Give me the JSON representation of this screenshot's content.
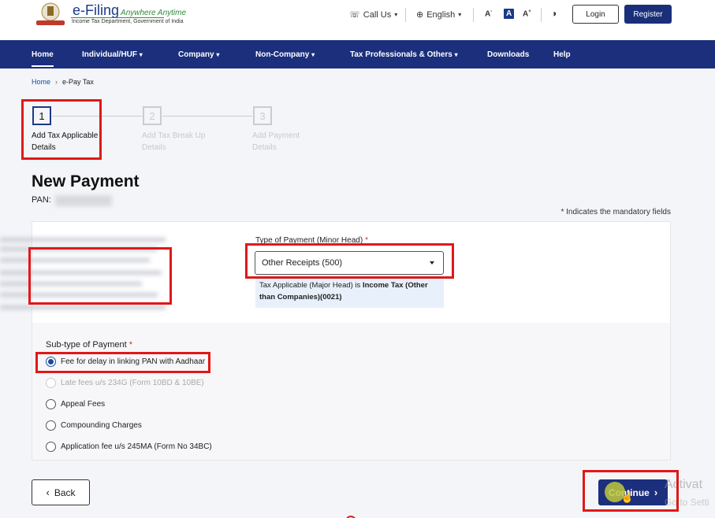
{
  "header": {
    "logo_title": "e-Filing",
    "logo_tagline": "Anywhere Anytime",
    "logo_subtitle": "Income Tax Department, Government of India",
    "call_us": "Call Us",
    "language": "English",
    "font_decrease": "A",
    "font_normal": "A",
    "font_increase": "A",
    "login": "Login",
    "register": "Register"
  },
  "nav": {
    "items": [
      "Home",
      "Individual/HUF",
      "Company",
      "Non-Company",
      "Tax Professionals & Others",
      "Downloads",
      "Help"
    ]
  },
  "breadcrumb": {
    "home": "Home",
    "current": "e-Pay Tax"
  },
  "stepper": [
    {
      "number": "1",
      "label": "Add Tax Applicable Details"
    },
    {
      "number": "2",
      "label": "Add Tax Break Up Details"
    },
    {
      "number": "3",
      "label": "Add Payment Details"
    }
  ],
  "page": {
    "title": "New Payment",
    "pan_label": "PAN:",
    "mandatory_note": "* Indicates the mandatory fields"
  },
  "form": {
    "type_label": "Type of Payment (Minor Head)",
    "required_mark": "*",
    "type_value": "Other Receipts (500)",
    "info_prefix": "Tax Applicable (Major Head) is",
    "info_bold": "Income Tax (Other than Companies)(0021)",
    "subtype_label": "Sub-type of Payment",
    "subtype_options": [
      {
        "label": "Fee for delay in linking PAN with Aadhaar",
        "checked": true,
        "disabled": false
      },
      {
        "label": "Late fees u/s 234G (Form 10BD & 10BE)",
        "checked": false,
        "disabled": true
      },
      {
        "label": "Appeal Fees",
        "checked": false,
        "disabled": false
      },
      {
        "label": "Compounding Charges",
        "checked": false,
        "disabled": false
      },
      {
        "label": "Application fee u/s 245MA (Form No 34BC)",
        "checked": false,
        "disabled": false
      }
    ]
  },
  "actions": {
    "back": "Back",
    "continue": "Continue"
  },
  "overlay": {
    "watermark": "Activat",
    "watermark_sub": "Go to Setti"
  },
  "colors": {
    "nav_bg": "#1b2f7d",
    "highlight": "#e01818",
    "link": "#1a4aa0"
  }
}
